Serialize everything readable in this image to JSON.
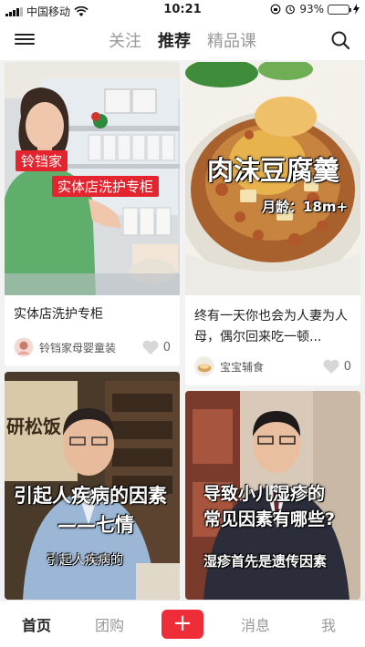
{
  "status_bar": {
    "carrier": "中国移动",
    "time": "10:21",
    "battery": "93%",
    "battery_level": 0.93
  },
  "top_nav": {
    "tabs": [
      {
        "label": "关注"
      },
      {
        "label": "推荐"
      },
      {
        "label": "精品课"
      }
    ],
    "active_tab": "推荐"
  },
  "feed": [
    {
      "overlay_tags": [
        "铃铛家",
        "实体店洗护专柜"
      ],
      "title": "实体店洗护专柜",
      "author": "铃铛家母婴童装",
      "likes": "0"
    },
    {
      "overlay_title": "肉沫豆腐羹",
      "overlay_sub": "月龄：18m+",
      "title": "终有一天你也会为人妻为人母，偶尔回来吃一顿...",
      "author": "宝宝辅食",
      "likes": "0"
    },
    {
      "overlay_line1": "引起人疾病的因素",
      "overlay_line2": "——七情",
      "overlay_line3": "引起人疾病的",
      "sign_text": "研松饭"
    },
    {
      "overlay_line1": "导致小儿湿疹的",
      "overlay_line2": "常见因素有哪些?",
      "overlay_line3": "湿疹首先是遗传因素"
    }
  ],
  "bottom_bar": {
    "items": [
      {
        "label": "首页"
      },
      {
        "label": "团购"
      },
      {
        "label": "+"
      },
      {
        "label": "消息"
      },
      {
        "label": "我"
      }
    ],
    "active": "首页"
  },
  "colors": {
    "accent_red": "#ef2d39",
    "battery_green": "#35c759"
  }
}
